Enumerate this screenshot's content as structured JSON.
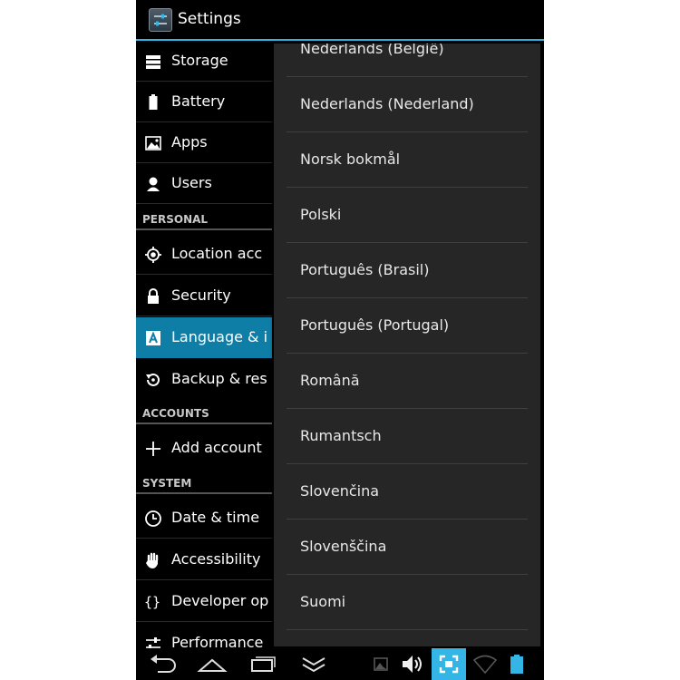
{
  "app": {
    "title": "Settings"
  },
  "sidebar": {
    "items": [
      {
        "label": "Storage"
      },
      {
        "label": "Battery"
      },
      {
        "label": "Apps"
      },
      {
        "label": "Users"
      },
      {
        "label": "Location acc"
      },
      {
        "label": "Security"
      },
      {
        "label": "Language & i"
      },
      {
        "label": "Backup & res"
      },
      {
        "label": "Add account"
      },
      {
        "label": "Date & time"
      },
      {
        "label": "Accessibility"
      },
      {
        "label": "Developer op"
      },
      {
        "label": "Performance"
      }
    ],
    "headers": {
      "personal": "PERSONAL",
      "accounts": "ACCOUNTS",
      "system": "SYSTEM"
    }
  },
  "dropdown": {
    "options": [
      {
        "label": "Nederlands (België)"
      },
      {
        "label": "Nederlands (Nederland)"
      },
      {
        "label": "Norsk bokmål"
      },
      {
        "label": "Polski"
      },
      {
        "label": "Português (Brasil)"
      },
      {
        "label": "Português (Portugal)"
      },
      {
        "label": "Română"
      },
      {
        "label": "Rumantsch"
      },
      {
        "label": "Slovenčina"
      },
      {
        "label": "Slovenščina"
      },
      {
        "label": "Suomi"
      }
    ]
  },
  "colors": {
    "accent": "#33b5e5",
    "selected": "#0f7ea6",
    "dropdown_bg": "#262626"
  },
  "icons": {
    "nav": [
      "back-icon",
      "home-icon",
      "recents-icon",
      "hide-icon"
    ],
    "status": [
      "gallery-icon",
      "volume-icon",
      "screenshot-icon",
      "wifi-icon",
      "battery-icon"
    ]
  }
}
